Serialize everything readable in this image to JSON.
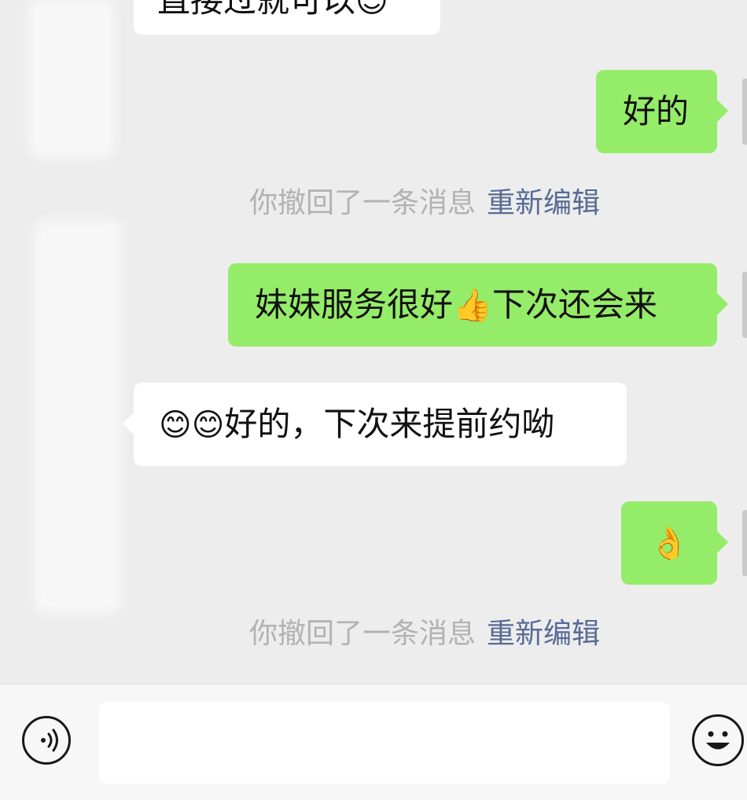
{
  "messages": {
    "m0": {
      "text": "直接过就可以",
      "emoji": "😊"
    },
    "m1": {
      "text": "好的"
    },
    "m2": {
      "text": "你撤回了一条消息",
      "link": "重新编辑"
    },
    "m3": {
      "text1": "妹妹服务很好",
      "emoji": "👍",
      "text2": "下次还会来"
    },
    "m4": {
      "emoji": "😊😊",
      "text": "好的，下次来提前约呦"
    },
    "m5": {
      "emoji": "👌"
    },
    "m6": {
      "text": "你撤回了一条消息",
      "link": "重新编辑"
    }
  },
  "icons": {
    "voice": "voice-icon",
    "emoji": "emoji-icon"
  },
  "colors": {
    "outgoing_bubble": "#95ec69",
    "incoming_bubble": "#ffffff",
    "background": "#ededed",
    "system_text": "#b2b2b2",
    "link": "#576b95"
  }
}
